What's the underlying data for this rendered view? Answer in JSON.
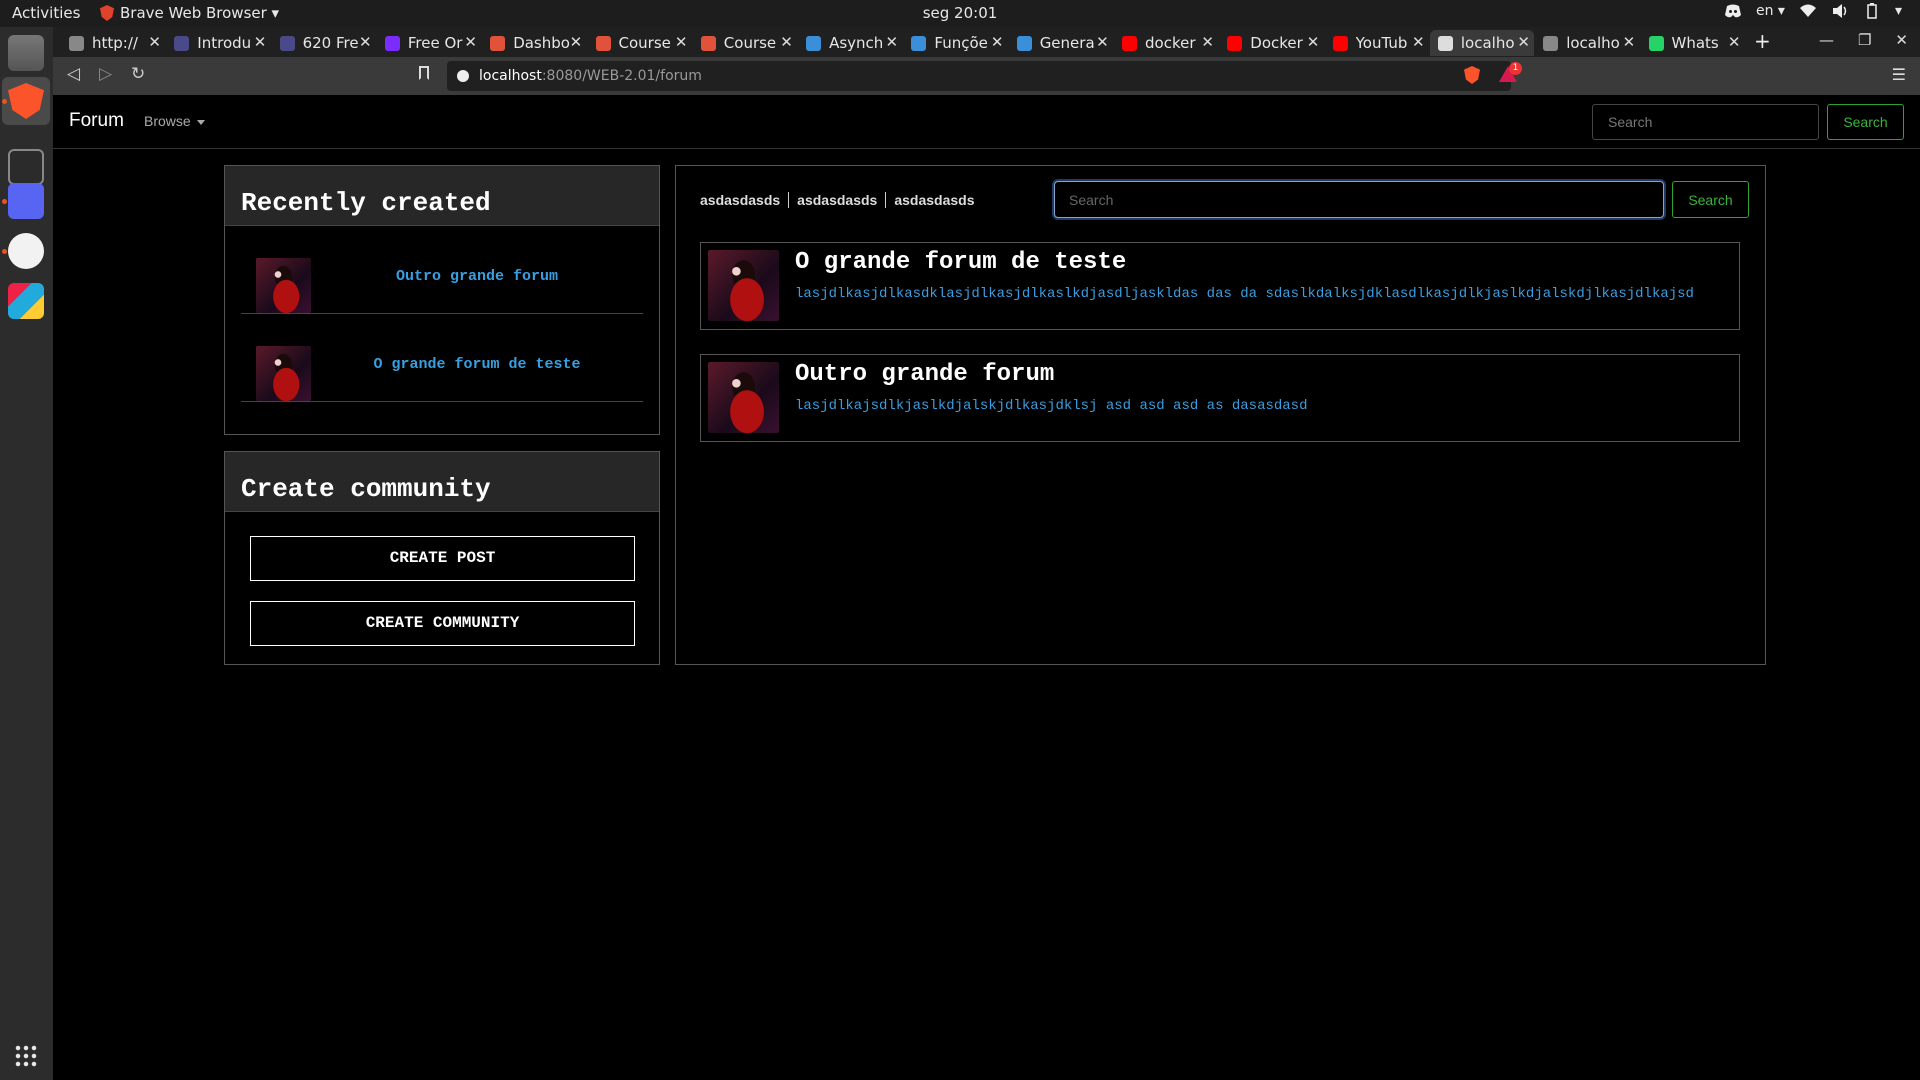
{
  "system": {
    "activities": "Activities",
    "app_menu": "Brave Web Browser ▾",
    "clock": "seg 20:01",
    "lang": "en ▾"
  },
  "tabs": [
    {
      "title": "http://",
      "favicon_color": "#888888"
    },
    {
      "title": "Introdu",
      "favicon_color": "#4a4a8a"
    },
    {
      "title": "620 Fre",
      "favicon_color": "#4a4a8a"
    },
    {
      "title": "Free Or",
      "favicon_color": "#7b2cff"
    },
    {
      "title": "Dashbo",
      "favicon_color": "#e0533a"
    },
    {
      "title": "Course",
      "favicon_color": "#e0533a"
    },
    {
      "title": "Course",
      "favicon_color": "#e0533a"
    },
    {
      "title": "Asynch",
      "favicon_color": "#3a8fd8"
    },
    {
      "title": "Funçõe",
      "favicon_color": "#3a8fd8"
    },
    {
      "title": "Genera",
      "favicon_color": "#3a8fd8"
    },
    {
      "title": "docker",
      "favicon_color": "#ff0000"
    },
    {
      "title": "Docker",
      "favicon_color": "#ff0000"
    },
    {
      "title": "YouTub",
      "favicon_color": "#ff0000"
    },
    {
      "title": "localho",
      "favicon_color": "#dddddd"
    },
    {
      "title": "localho",
      "favicon_color": "#888888"
    },
    {
      "title": "Whats",
      "favicon_color": "#25d366"
    }
  ],
  "address": {
    "host": "localhost",
    "path": ":8080/WEB-2.01/forum"
  },
  "rewards_badge": "1",
  "navbar": {
    "brand": "Forum",
    "browse": "Browse",
    "search_placeholder": "Search",
    "search_button": "Search"
  },
  "recent": {
    "heading": "Recently created",
    "items": [
      {
        "label": "Outro grande forum"
      },
      {
        "label": "O grande forum de teste"
      }
    ]
  },
  "community": {
    "heading": "Create community",
    "create_post": "CREATE POST",
    "create_community": "CREATE COMMUNITY"
  },
  "main": {
    "crumbs": [
      "asdasdasds",
      "asdasdasds",
      "asdasdasds"
    ],
    "search_placeholder": "Search",
    "search_button": "Search",
    "posts": [
      {
        "title": "O grande forum de teste",
        "body": "lasjdlkasjdlkasdklasjdlkasjdlkaslkdjasdljaskldas das da sdaslkdalksjdklasdlkasjdlkjaslkdjalskdjlkasjdlkajsd"
      },
      {
        "title": "Outro grande forum",
        "body": "lasjdlkajsdlkjaslkdjalskjdlkasjdklsj asd asd asd as dasasdasd"
      }
    ]
  }
}
